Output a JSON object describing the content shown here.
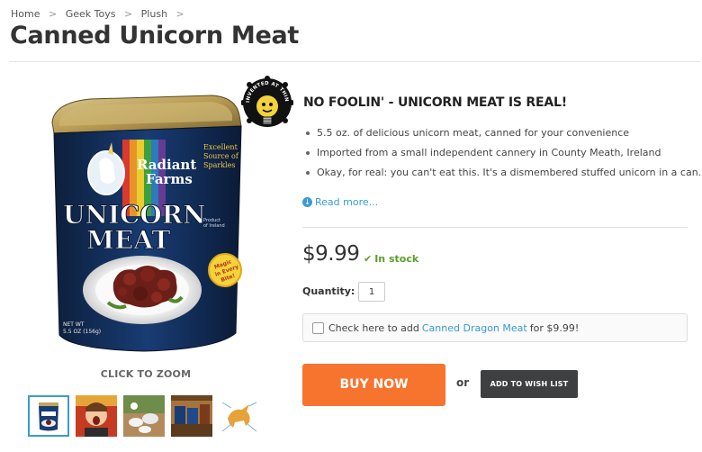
{
  "breadcrumb": [
    "Home",
    "Geek Toys",
    "Plush"
  ],
  "breadcrumb_separator": ">",
  "title": "Canned Unicorn Meat",
  "image": {
    "click_to_zoom": "CLICK TO ZOOM",
    "can_label": {
      "brand_line1": "Radiant",
      "brand_line2": "Farms",
      "tagline_1": "Excellent",
      "tagline_2": "Source of",
      "tagline_3": "Sparkles",
      "word_1": "UNICORN",
      "word_2": "MEAT",
      "product_of_1": "Product",
      "product_of_2": "of Ireland",
      "magic_1": "Magic",
      "magic_2": "in Every",
      "magic_3": "Bite!",
      "net_wt_1": "NET WT",
      "net_wt_2": "5.5 OZ (156g)"
    }
  },
  "badge": {
    "text": "INVENTED AT THINKGEEK"
  },
  "product": {
    "headline": "NO FOOLIN' - UNICORN MEAT IS REAL!",
    "features": [
      "5.5 oz. of delicious unicorn meat, canned for your convenience",
      "Imported from a small independent cannery in County Meath, Ireland",
      "Okay, for real: you can't eat this. It's a dismembered stuffed unicorn in a can."
    ],
    "read_more": "Read more..."
  },
  "price": "$9.99",
  "stock_status": "In stock",
  "quantity": {
    "label": "Quantity:",
    "value": "1"
  },
  "addon": {
    "prefix": "Check here to add",
    "link": "Canned Dragon Meat",
    "suffix": "for $9.99!"
  },
  "buttons": {
    "buy_now": "BUY NOW",
    "or": "or",
    "wishlist": "ADD TO WISH LIST"
  },
  "thumbnails": [
    {
      "name": "can-front"
    },
    {
      "name": "screaming-boy"
    },
    {
      "name": "mushrooms-toy"
    },
    {
      "name": "cans-on-shelf"
    },
    {
      "name": "unicorn-diagram"
    }
  ],
  "colors": {
    "accent": "#f7742e",
    "link": "#3a9bd1",
    "stock_green": "#5aa02c",
    "wishlist_bg": "#3d3f41"
  }
}
